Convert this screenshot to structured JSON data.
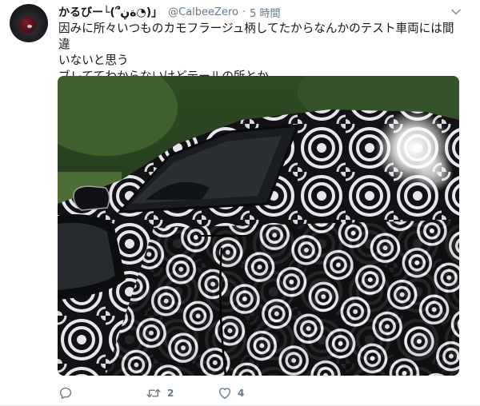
{
  "tweet": {
    "display_name": "かるびー└(՞ةڼ◔)」",
    "handle": "@CalbeeZero",
    "separator": "·",
    "time": "5 時間",
    "text_lines": [
      "因みに所々いつものカモフラージュ柄してたからなんかのテスト車両には間違",
      "いないと思う",
      "ブレててわからないけどテールの所とか"
    ],
    "media_alt": "camouflaged test car with black and white swirl wrap",
    "actions": {
      "reply_icon": "reply-icon",
      "retweet_icon": "retweet-icon",
      "retweet_count": "2",
      "like_icon": "heart-icon",
      "like_count": "4"
    }
  },
  "colors": {
    "text_primary": "#14171a",
    "text_secondary": "#657786",
    "border": "#e6ecf0"
  }
}
